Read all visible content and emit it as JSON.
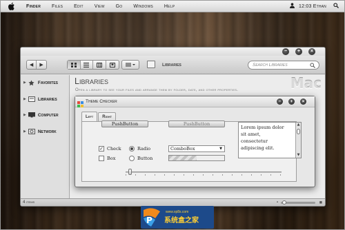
{
  "menubar": {
    "items": [
      "Finder",
      "Files",
      "Edit",
      "View",
      "Go",
      "Windows",
      "Help"
    ],
    "clock": "12:03 Ethan"
  },
  "finder": {
    "location_label": "Libraries",
    "search_placeholder": "Search Libraries",
    "sidebar": [
      "Favorites",
      "Libraries",
      "Computer",
      "Network"
    ],
    "title": "Libraries",
    "subtitle": "Open a library to see your files and arrange them by folder, date, and other properties.",
    "brand": "Mac",
    "status": "4 items",
    "zoom_level": 0.1
  },
  "dialog": {
    "title": "Theme Checker",
    "tabs": [
      "Left",
      "Right"
    ],
    "active_tab": "Left",
    "push_button_1": "PushButton",
    "push_button_2": "PushButton",
    "check_label": "Check",
    "box_label": "Box",
    "radio_label": "Radio",
    "button_label": "Button",
    "combo_value": "ComboBox",
    "progress_fraction": 0.5,
    "text_lines": [
      "Lorem ipsum dolor",
      "sit amet,",
      "consectetur",
      "adipiscing elit."
    ],
    "slider_fraction": 0.02
  },
  "watermark": {
    "url": "www.xp8s.com",
    "name": "系统盒之家"
  }
}
